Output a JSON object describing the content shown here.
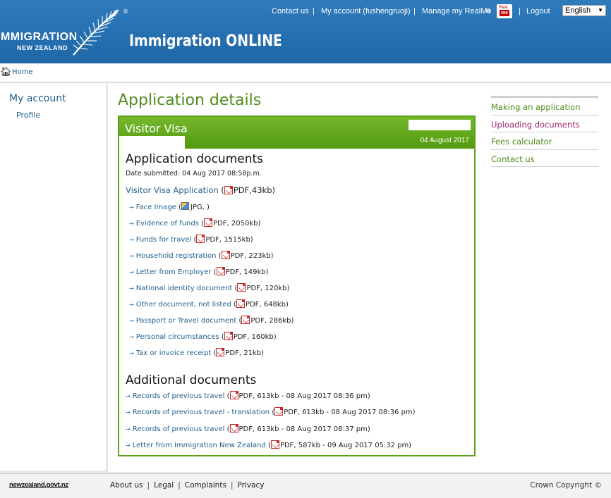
{
  "header": {
    "logo_line1": "IMMIGRATION",
    "logo_line2": "NEW ZEALAND",
    "site_title": "Immigration ONLINE",
    "top_links": {
      "contact": "Contact us",
      "account": "My account (fushengruoji)",
      "realme": "Manage my RealMe",
      "logout": "Logout",
      "sep": "|"
    },
    "realme_icon": {
      "line1": "Real",
      "line2": "me"
    },
    "language": {
      "selected": "English"
    }
  },
  "breadcrumb": {
    "home": "Home"
  },
  "leftnav": {
    "my_account": "My account",
    "profile": "Profile"
  },
  "main": {
    "page_title": "Application details",
    "visa": {
      "title": "Visitor Visa",
      "date": "04 August 2017"
    },
    "application_documents": {
      "heading": "Application documents",
      "submitted": "Date submitted: 04 Aug 2017  08:58p.m.",
      "main_doc": {
        "label": "Visitor Visa Application",
        "meta": "PDF,43kb)"
      },
      "docs": [
        {
          "label": "Face Image",
          "meta": "JPG, )",
          "type": "jpg"
        },
        {
          "label": "Evidence of funds",
          "meta": "PDF, 2050kb)",
          "type": "pdf"
        },
        {
          "label": "Funds for travel",
          "meta": "PDF, 1515kb)",
          "type": "pdf"
        },
        {
          "label": "Household registration",
          "meta": "PDF, 223kb)",
          "type": "pdf"
        },
        {
          "label": "Letter from Employer",
          "meta": "PDF, 149kb)",
          "type": "pdf"
        },
        {
          "label": "National identity document",
          "meta": "PDF, 120kb)",
          "type": "pdf"
        },
        {
          "label": "Other document, not listed",
          "meta": "PDF, 648kb)",
          "type": "pdf"
        },
        {
          "label": "Passport or Travel document",
          "meta": "PDF, 286kb)",
          "type": "pdf"
        },
        {
          "label": "Personal circumstances",
          "meta": "PDF, 160kb)",
          "type": "pdf"
        },
        {
          "label": "Tax or invoice receipt",
          "meta": "PDF, 21kb)",
          "type": "pdf"
        }
      ]
    },
    "additional_documents": {
      "heading": "Additional documents",
      "docs": [
        {
          "label": "Records of previous travel",
          "meta": "PDF, 613kb - 08 Aug 2017 08:36 pm)"
        },
        {
          "label": "Records of previous travel - translation",
          "meta": "PDF, 613kb - 08 Aug 2017 08:36 pm)"
        },
        {
          "label": "Records of previous travel",
          "meta": "PDF, 613kb - 08 Aug 2017 08:37 pm)"
        },
        {
          "label": "Letter from Immigration New Zealand",
          "meta": "PDF, 587kb - 09 Aug 2017 05:32 pm)"
        }
      ]
    }
  },
  "rightnav": {
    "items": [
      {
        "label": "Making an application",
        "color": "#4e8d1a"
      },
      {
        "label": "Uploading documents",
        "color": "#a0256e"
      },
      {
        "label": "Fees calculator",
        "color": "#4e8d1a"
      },
      {
        "label": "Contact us",
        "color": "#4e8d1a"
      }
    ]
  },
  "footer": {
    "govt": "newzealand.govt.nz",
    "links": [
      "About us",
      "Legal",
      "Complaints",
      "Privacy"
    ],
    "sep": "|",
    "copyright": "Crown Copyright ©"
  }
}
